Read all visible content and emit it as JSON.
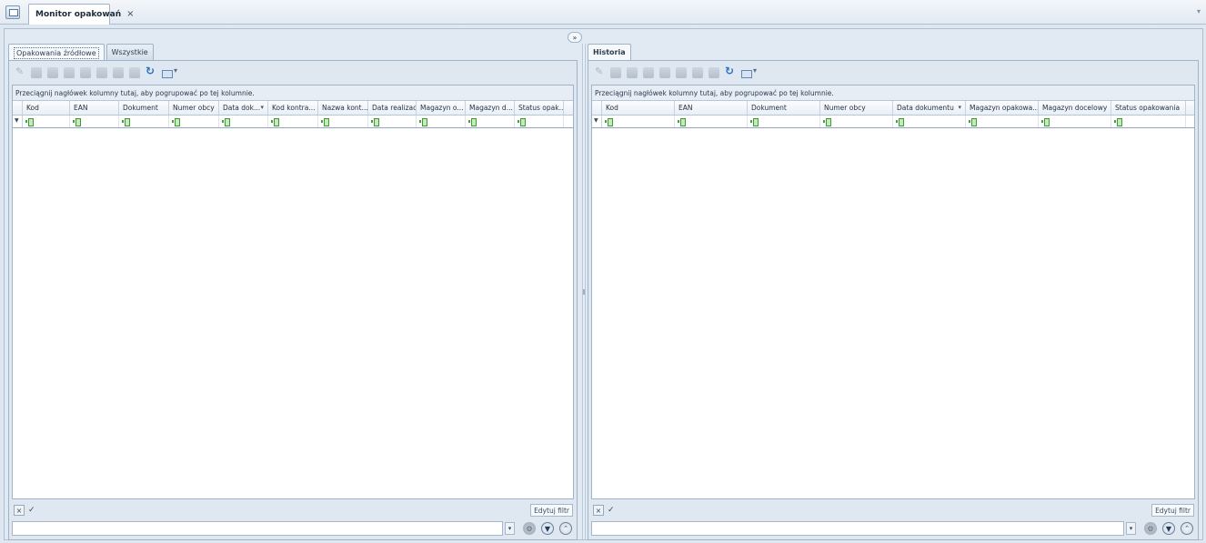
{
  "window": {
    "tab_title": "Monitor opakowań",
    "close_glyph": "×"
  },
  "left": {
    "tabs": [
      "Opakowania źródłowe",
      "Wszystkie"
    ],
    "active_tab": 0,
    "group_hint": "Przeciągnij nagłówek kolumny tutaj, aby pogrupować po tej kolumnie.",
    "columns": [
      "Kod",
      "EAN",
      "Dokument",
      "Numer obcy",
      "Data dok...",
      "Kod kontra...",
      "Nazwa kont...",
      "Data realizacji",
      "Magazyn o...",
      "Magazyn d...",
      "Status opak..."
    ],
    "sorted_column": 4,
    "edit_filter_label": "Edytuj filtr",
    "search_value": ""
  },
  "right": {
    "tabs": [
      "Historia"
    ],
    "active_tab": 0,
    "group_hint": "Przeciągnij nagłówek kolumny tutaj, aby pogrupować po tej kolumnie.",
    "columns": [
      "Kod",
      "EAN",
      "Dokument",
      "Numer obcy",
      "Data dokumentu",
      "Magazyn opakowa...",
      "Magazyn docelowy",
      "Status opakowania"
    ],
    "sorted_column": 4,
    "edit_filter_label": "Edytuj filtr",
    "search_value": ""
  },
  "icons": {
    "toolbar": [
      "wrench-icon",
      "preview-icon",
      "binoculars-icon",
      "grid-icon",
      "print-icon",
      "export-icon",
      "copy-icon",
      "clipboard-icon",
      "refresh-icon",
      "view-dropdown-icon"
    ],
    "collapse": "»"
  }
}
